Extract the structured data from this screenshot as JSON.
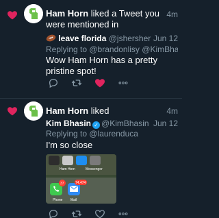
{
  "colors": {
    "background": "#15202b",
    "like_red": "#e0245e",
    "muted": "#8899a6",
    "verified_blue": "#1da1f2"
  },
  "notifications": [
    {
      "type_icon": "heart-icon",
      "actor": "Ham Horn",
      "action": " liked a Tweet you were mentioned in",
      "age": "4m",
      "tweet": {
        "name": "leave florida",
        "handle": "@jshersher",
        "date": "Jun 12",
        "replying": "Replying to @brandonlisy @KimBhasin ...",
        "text": "Wow Ham Horn has a pretty pristine spot!",
        "liked": true
      }
    },
    {
      "type_icon": "heart-icon",
      "actor": "Ham Horn",
      "action": " liked",
      "age": "4m",
      "tweet": {
        "name": "Kim Bhasin",
        "handle": "@KimBhasin",
        "date": "Jun 12",
        "replying": "Replying to @laurenduca",
        "text": "I'm so close",
        "liked": false,
        "image": {
          "labels": [
            "Ham Horn",
            "Messenger",
            "Phone",
            "Mail"
          ],
          "badges": [
            "37",
            "74,474"
          ]
        }
      }
    }
  ]
}
